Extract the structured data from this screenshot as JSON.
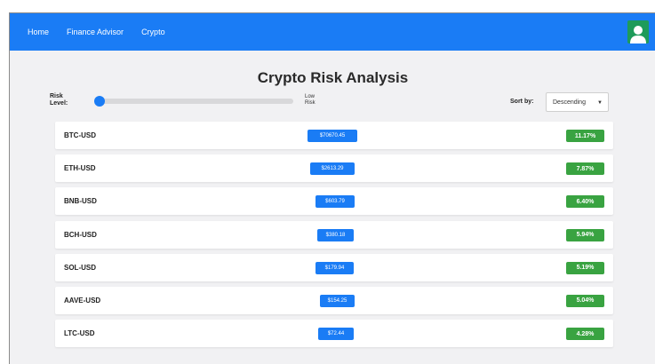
{
  "nav": {
    "links": [
      "Home",
      "Finance Advisor",
      "Crypto"
    ]
  },
  "page": {
    "title": "Crypto Risk Analysis",
    "risk_label_line1": "Risk",
    "risk_label_line2": "Level:",
    "risk_value_line1": "Low",
    "risk_value_line2": "Risk",
    "risk_slider_level": 0,
    "sort_label": "Sort by:",
    "sort_value": "Descending"
  },
  "rows": [
    {
      "symbol": "BTC-USD",
      "price": "$70670.45",
      "change": "11.17%"
    },
    {
      "symbol": "ETH-USD",
      "price": "$2613.29",
      "change": "7.87%"
    },
    {
      "symbol": "BNB-USD",
      "price": "$603.79",
      "change": "6.40%"
    },
    {
      "symbol": "BCH-USD",
      "price": "$380.18",
      "change": "5.94%"
    },
    {
      "symbol": "SOL-USD",
      "price": "$179.94",
      "change": "5.19%"
    },
    {
      "symbol": "AAVE-USD",
      "price": "$154.25",
      "change": "5.04%"
    },
    {
      "symbol": "LTC-USD",
      "price": "$72.44",
      "change": "4.28%"
    }
  ],
  "colors": {
    "primary": "#1a7cf5",
    "positive": "#39a341",
    "avatar": "#1e9b5a"
  },
  "icons": {
    "avatar": "user-avatar-icon",
    "caret": "chevron-down-icon"
  }
}
